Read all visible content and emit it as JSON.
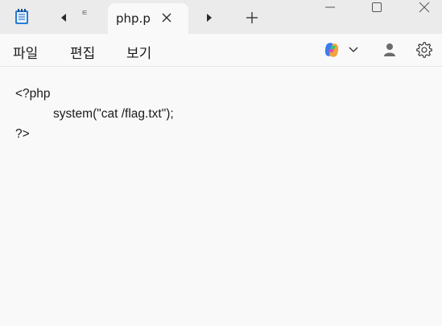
{
  "tabs": {
    "clipped_tab_text": "ㅌ",
    "active_tab_label": "php.p"
  },
  "menu": {
    "file": "파일",
    "edit": "편집",
    "view": "보기"
  },
  "editor": {
    "lines": [
      "<?php",
      "system(\"cat /flag.txt\");",
      "?>"
    ]
  },
  "icons": {
    "app": "notepad-icon",
    "tab_left": "scroll-left-icon",
    "tab_close": "close-icon",
    "tab_right": "scroll-right-icon",
    "new_tab": "plus-icon",
    "minimize": "minimize-icon",
    "maximize": "maximize-icon",
    "window_close": "window-close-icon",
    "copilot": "copilot-icon",
    "dropdown": "chevron-down-icon",
    "profile": "profile-icon",
    "settings": "gear-icon"
  },
  "colors": {
    "titlebar": "#ebebeb",
    "background": "#f9f9f9",
    "text": "#1b1b1b",
    "app_icon": "#2b7cd3"
  }
}
